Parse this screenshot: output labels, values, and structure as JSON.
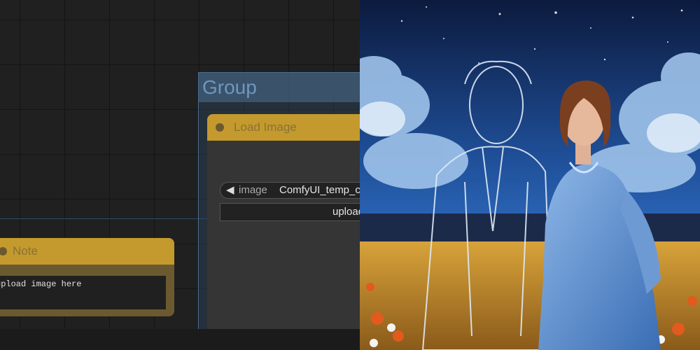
{
  "group": {
    "title": "Group"
  },
  "load_image_node": {
    "title": "Load Image",
    "image_widget": {
      "arrow": "◀",
      "label": "image",
      "value": "ComfyUI_temp_c"
    },
    "upload_button": "upload"
  },
  "note_node": {
    "title": "Note",
    "text": "upload image here"
  },
  "preview": {
    "description_icon": "painting-preview"
  }
}
